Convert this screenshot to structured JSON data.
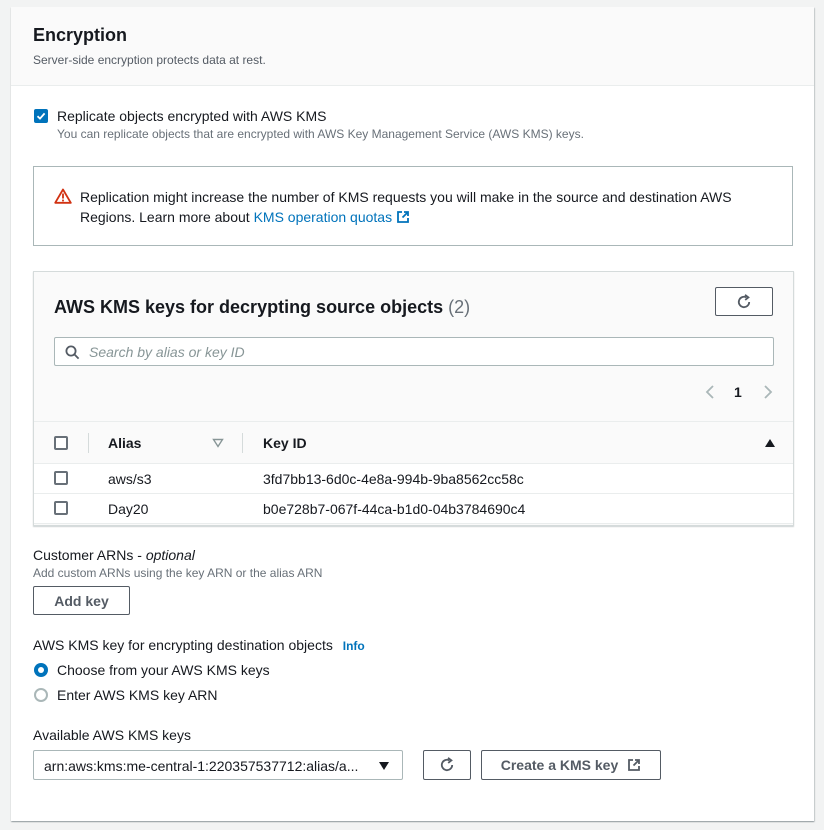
{
  "section": {
    "title": "Encryption",
    "description": "Server-side encryption protects data at rest."
  },
  "replicate": {
    "label": "Replicate objects encrypted with AWS KMS",
    "description": "You can replicate objects that are encrypted with AWS Key Management Service (AWS KMS) keys.",
    "checked": true
  },
  "alert": {
    "icon": "warning-icon",
    "text_line1": "Replication might increase the number of KMS requests you will make in the source and destination AWS",
    "text_line2": "Regions. Learn more about",
    "link": "KMS operation quotas",
    "link_icon": "external-link-icon"
  },
  "keys_table": {
    "title": "AWS KMS keys for decrypting source objects",
    "count": "(2)",
    "search_placeholder": "Search by alias or key ID",
    "page": "1",
    "columns": [
      "Alias",
      "Key ID"
    ],
    "rows": [
      {
        "alias": "aws/s3",
        "key_id": "3fd7bb13-6d0c-4e8a-994b-9ba8562cc58c",
        "selected": false
      },
      {
        "alias": "Day20",
        "key_id": "b0e728b7-067f-44ca-b1d0-04b3784690c4",
        "selected": false
      }
    ]
  },
  "customer_arns": {
    "label": "Customer ARNs",
    "optional": "optional",
    "separator": " - ",
    "description": "Add custom ARNs using the key ARN or the alias ARN",
    "add_button": "Add key"
  },
  "destination": {
    "label": "AWS KMS key for encrypting destination objects",
    "info": "Info",
    "options": [
      {
        "label": "Choose from your AWS KMS keys",
        "selected": true
      },
      {
        "label": "Enter AWS KMS key ARN",
        "selected": false
      }
    ]
  },
  "available_keys": {
    "label": "Available AWS KMS keys",
    "selected_value": "arn:aws:kms:me-central-1:220357537712:alias/a...",
    "create_button": "Create a KMS key"
  },
  "colors": {
    "accent": "#0073bb",
    "warning": "#d13212",
    "text": "#16191f",
    "muted": "#687078"
  }
}
